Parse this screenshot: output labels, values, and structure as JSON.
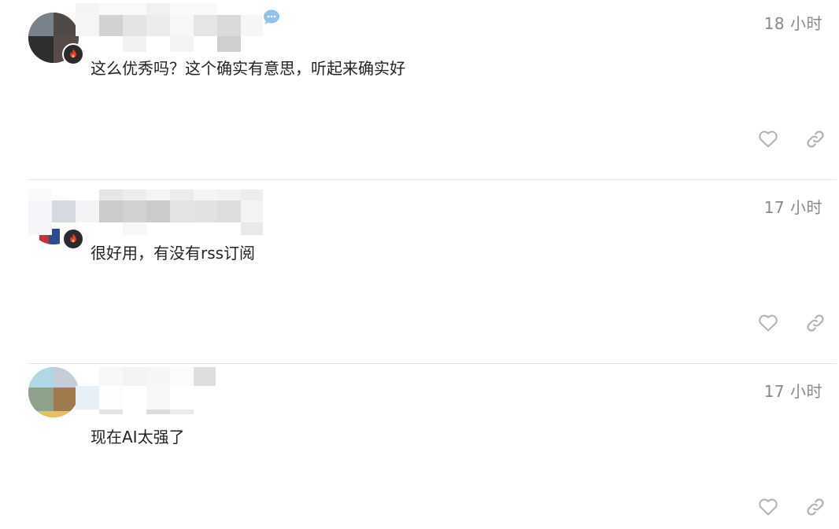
{
  "posts": [
    {
      "timestamp": "18 小时",
      "text": "这么优秀吗？这个确实有意思，听起来确实好",
      "has_flair": true,
      "has_chat_badge": true,
      "actions": {
        "like_icon": "heart-outline-icon",
        "link_icon": "link-icon"
      }
    },
    {
      "timestamp": "17 小时",
      "text": "很好用，有没有rss订阅",
      "has_flair": true,
      "has_chat_badge": false,
      "actions": {
        "like_icon": "heart-outline-icon",
        "link_icon": "link-icon"
      }
    },
    {
      "timestamp": "17 小时",
      "text": "现在AI太强了",
      "has_flair": false,
      "has_chat_badge": false,
      "actions": {
        "like_icon": "heart-outline-icon",
        "link_icon": "link-icon"
      }
    }
  ],
  "colors": {
    "text": "#222222",
    "muted": "#8a8a8a",
    "icon": "#b3b3b3",
    "divider": "#e6e6e6",
    "flair_flame": "#e8432e",
    "chat_badge": "#8fc3ec"
  }
}
